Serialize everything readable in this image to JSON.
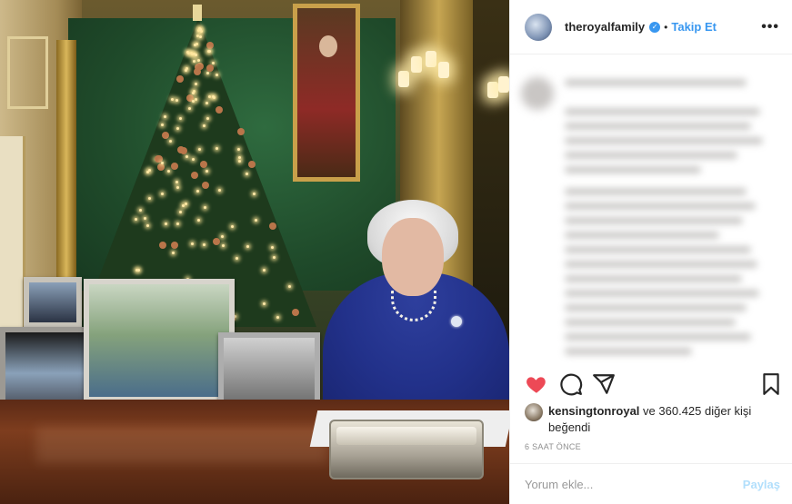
{
  "post": {
    "username": "theroyalfamily",
    "verified_mark": "✓",
    "separator": "•",
    "follow_label": "Takip Et",
    "more_label": "•••",
    "liked_by_user": "kensingtonroyal",
    "liked_by_rest": "ve 360.425 diğer kişi",
    "liked_by_suffix": "beğendi",
    "timestamp": "6 SAAT ÖNCE",
    "comment_placeholder": "Yorum ekle...",
    "share_label": "Paylaş",
    "like_state": "liked",
    "icons": [
      "heart-icon",
      "comment-icon",
      "share-icon",
      "bookmark-icon",
      "more-icon",
      "verified-icon"
    ],
    "colors": {
      "like": "#ed4956",
      "link": "#3897f0",
      "share_disabled": "#b2dffc"
    }
  }
}
